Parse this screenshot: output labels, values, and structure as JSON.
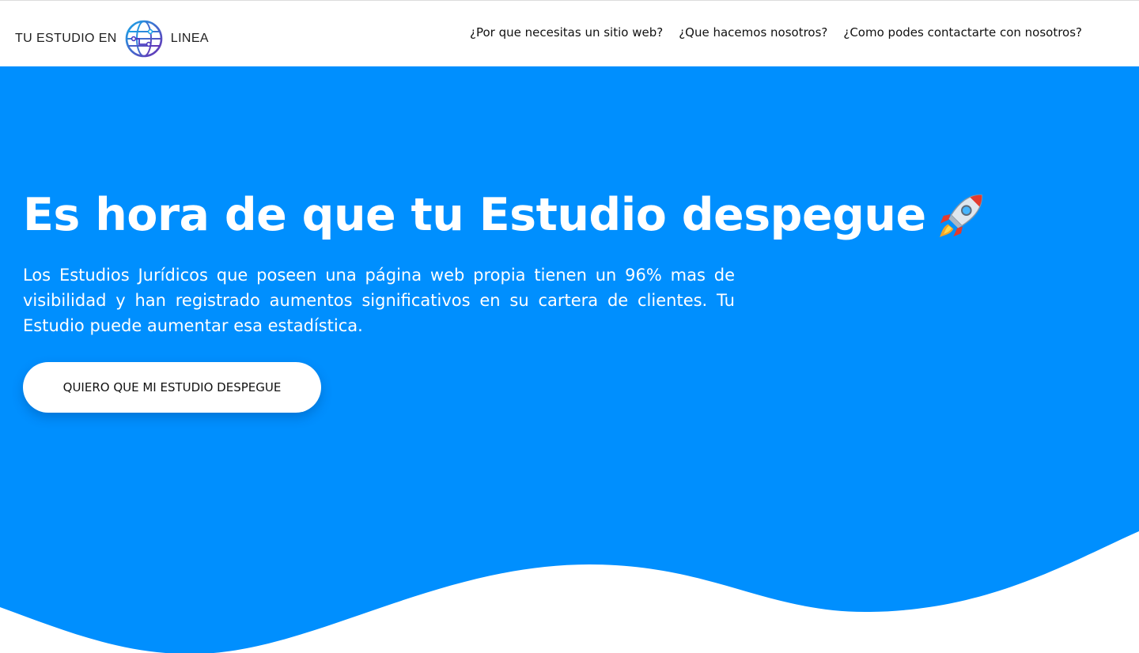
{
  "header": {
    "logo": {
      "text_left": "TU ESTUDIO EN",
      "text_right": "LINEA",
      "icon": "globe-icon"
    },
    "nav": [
      {
        "label": "¿Por que necesitas un sitio web?"
      },
      {
        "label": "¿Que hacemos nosotros?"
      },
      {
        "label": "¿Como podes contactarte con nosotros?"
      }
    ]
  },
  "hero": {
    "title": "Es hora de que tu Estudio despegue",
    "title_icon": "rocket-icon",
    "description": "Los Estudios Jurídicos que poseen una página web propia tienen un 96% mas de visibilidad y han registrado aumentos significativos en su cartera de clientes. Tu Estudio puede aumentar esa estadística.",
    "cta_label": "QUIERO QUE MI ESTUDIO DESPEGUE"
  },
  "colors": {
    "hero_background": "#008ffe",
    "header_background": "#ffffff",
    "text_on_hero": "#ffffff",
    "button_background": "#ffffff",
    "button_text": "#111111"
  }
}
